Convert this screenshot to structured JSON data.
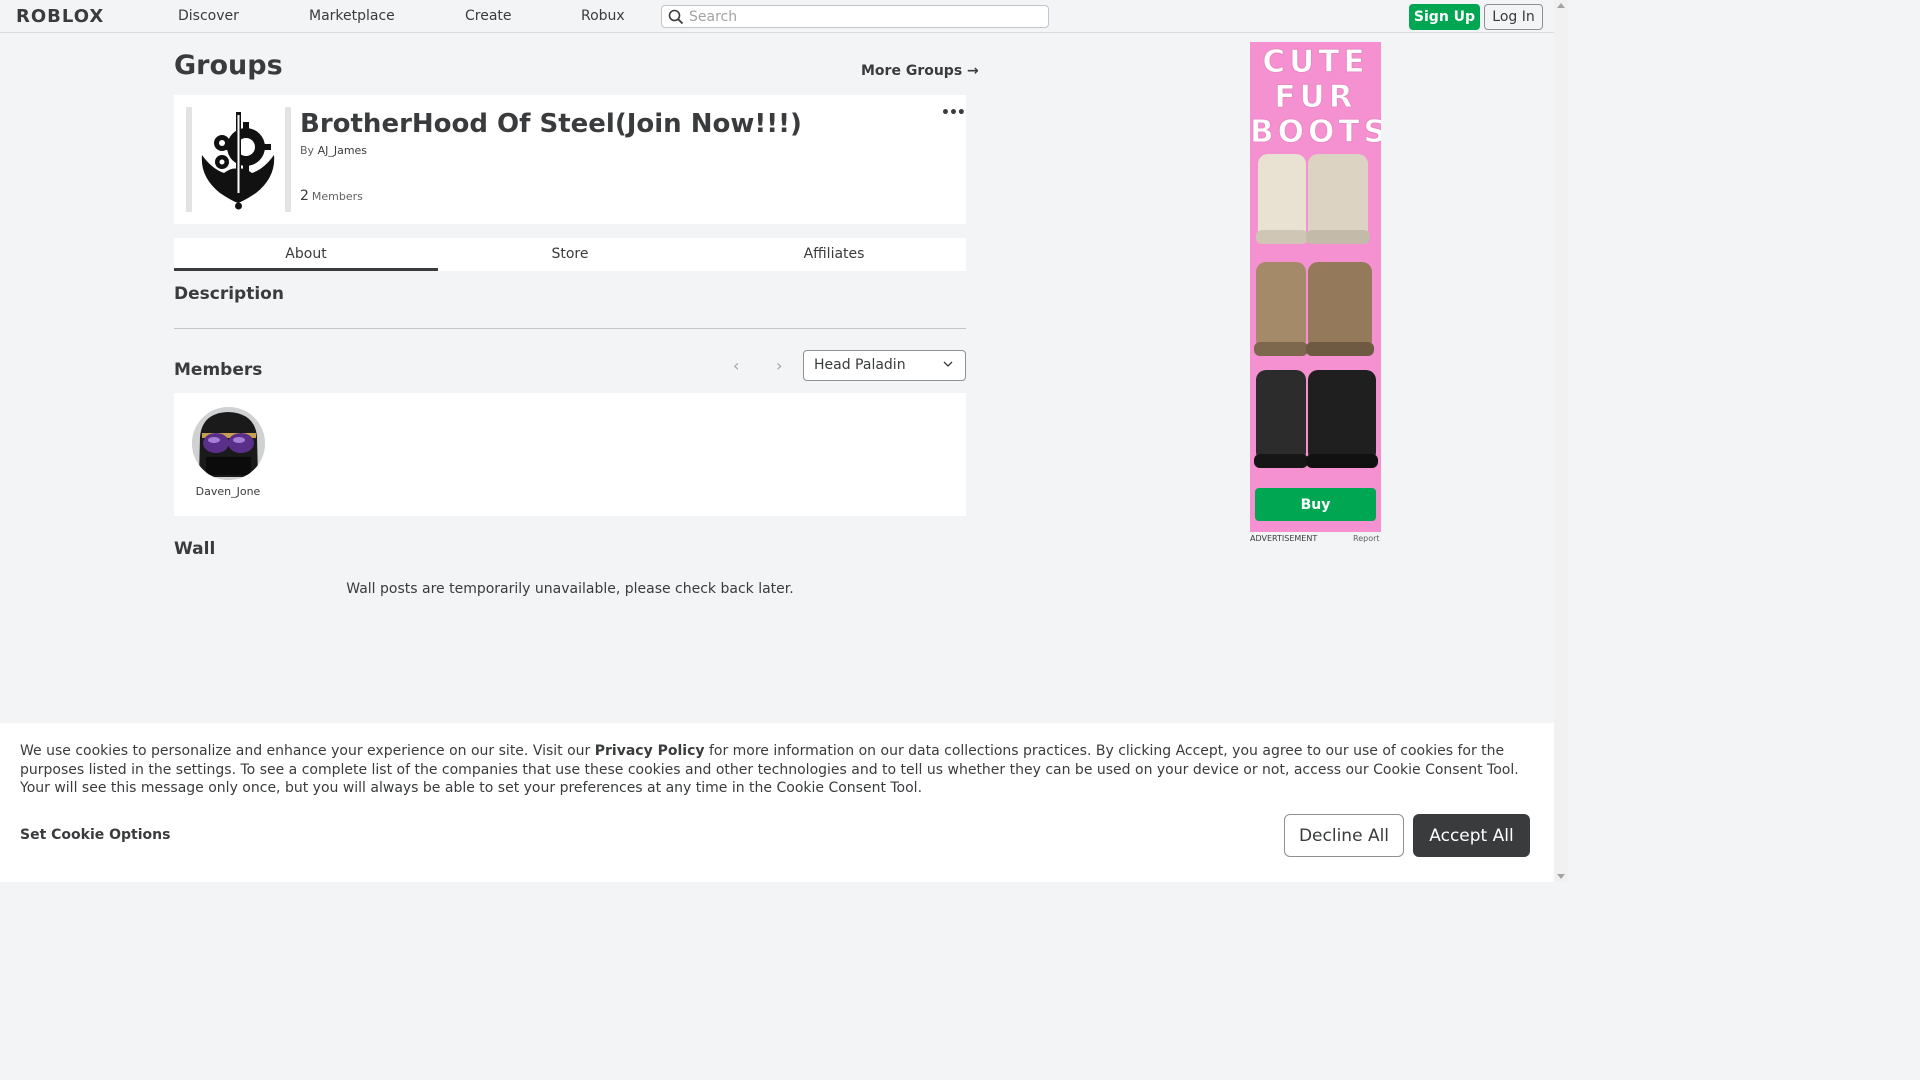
{
  "header": {
    "logo": "ROBLOX",
    "nav": [
      "Discover",
      "Marketplace",
      "Create",
      "Robux"
    ],
    "search_placeholder": "Search",
    "sign_up": "Sign Up",
    "log_in": "Log In"
  },
  "page": {
    "title": "Groups",
    "more_groups": "More Groups →"
  },
  "group": {
    "name": "BrotherHood Of Steel(Join Now!!!)",
    "by_label": "By",
    "owner": "AJ_James",
    "member_count": "2",
    "members_label": "Members",
    "more_menu": "•••"
  },
  "tabs": [
    "About",
    "Store",
    "Affiliates"
  ],
  "sections": {
    "description": "Description",
    "members": "Members",
    "wall": "Wall"
  },
  "members": {
    "selected_role": "Head Paladin",
    "list": [
      {
        "name": "Daven_Jone"
      }
    ]
  },
  "wall": {
    "message": "Wall posts are temporarily unavailable, please check back later."
  },
  "ad": {
    "lines": [
      "CUTE",
      "FUR",
      "BOOTS"
    ],
    "buy": "Buy",
    "label": "ADVERTISEMENT",
    "report": "Report"
  },
  "cookie": {
    "text_before": "We use cookies to personalize and enhance your experience on our site. Visit our ",
    "privacy_link": "Privacy Policy",
    "text_after": " for more information on our data collections practices. By clicking Accept, you agree to our use of cookies for the purposes listed in the settings. To see a complete list of the companies that use these cookies and other technologies and to tell us whether they can be used on your device or not, access our Cookie Consent Tool. Your will see this message only once, but you will always be able to set your preferences at any time in the Cookie Consent Tool.",
    "set_options": "Set Cookie Options",
    "decline": "Decline All",
    "accept": "Accept All"
  },
  "colors": {
    "brand_green": "#00a651",
    "ad_pink": "#f591d0",
    "accept_dark": "#393b3d"
  }
}
